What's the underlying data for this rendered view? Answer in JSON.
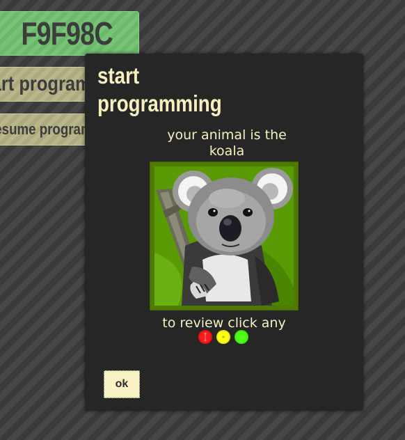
{
  "background": {
    "code_tile": {
      "text": "F9F98C",
      "color": "#6fbf6f"
    },
    "start_button": {
      "label": "start programming"
    },
    "resume_button": {
      "label": "resume programming"
    }
  },
  "dialog": {
    "title": "start programming",
    "message": "your animal is the koala",
    "animal": "koala",
    "review_text": "to review click any",
    "review_dots": [
      {
        "color": "#ff1a1a",
        "name": "red"
      },
      {
        "color": "#ffff1a",
        "name": "yellow"
      },
      {
        "color": "#4dff1a",
        "name": "green"
      }
    ],
    "ok_label": "ok"
  },
  "colors": {
    "modal_bg": "#262626",
    "text_cream": "#f6f0c0",
    "button_khaki": "#b5b184"
  }
}
